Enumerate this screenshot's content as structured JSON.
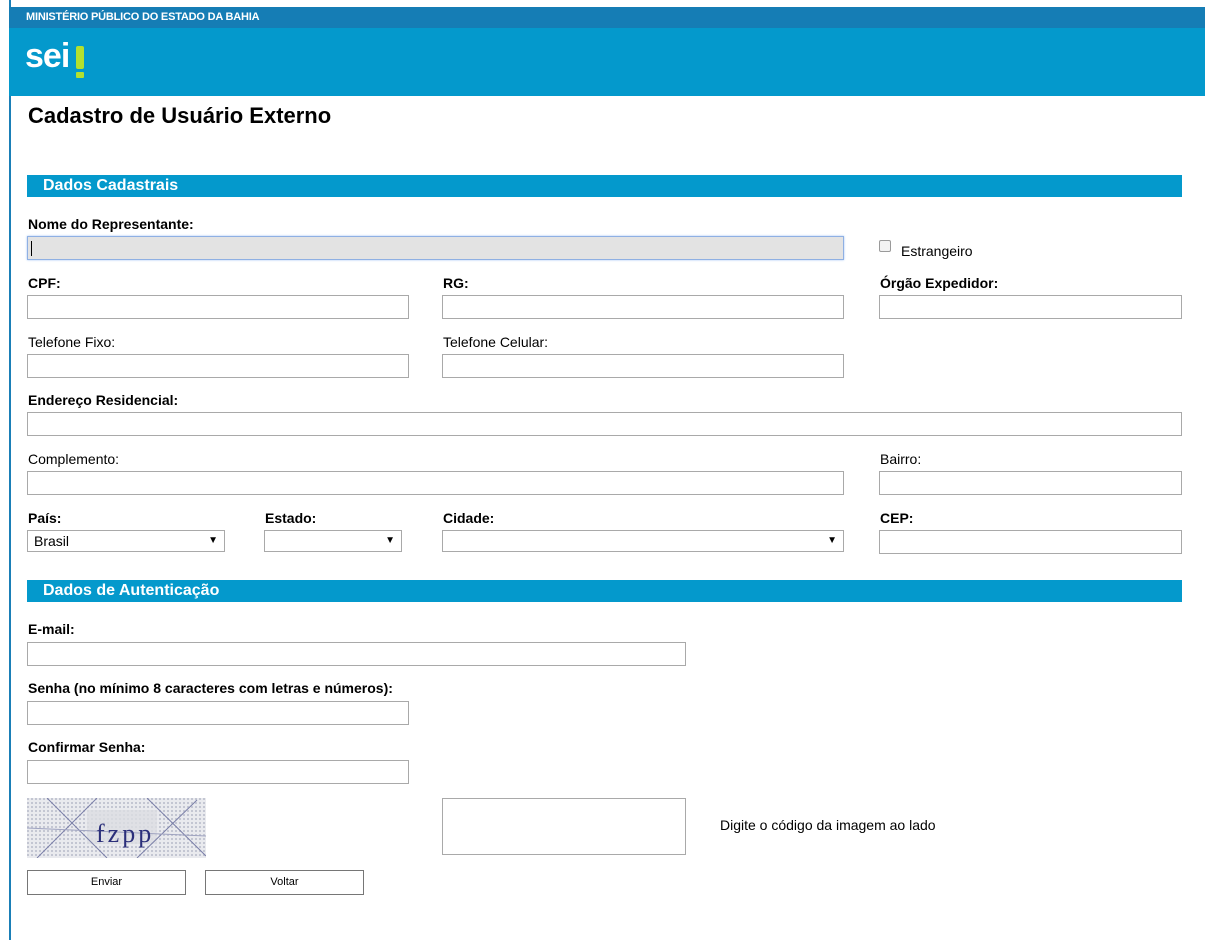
{
  "header": {
    "org_name": "MINISTÉRIO PÚBLICO DO ESTADO DA BAHIA",
    "logo_text": "sei"
  },
  "page": {
    "title": "Cadastro de Usuário Externo"
  },
  "sections": {
    "dados_cadastrais": "Dados Cadastrais",
    "dados_autenticacao": "Dados de Autenticação"
  },
  "labels": {
    "nome_representante": "Nome do Representante:",
    "estrangeiro": "Estrangeiro",
    "cpf": "CPF:",
    "rg": "RG:",
    "orgao_expedidor": "Órgão Expedidor:",
    "telefone_fixo": "Telefone Fixo:",
    "telefone_celular": "Telefone Celular:",
    "endereco_residencial": "Endereço Residencial:",
    "complemento": "Complemento:",
    "bairro": "Bairro:",
    "pais": "País:",
    "estado": "Estado:",
    "cidade": "Cidade:",
    "cep": "CEP:",
    "email": "E-mail:",
    "senha": "Senha (no mínimo 8 caracteres com letras e números):",
    "confirmar_senha": "Confirmar Senha:",
    "captcha_hint": "Digite o código da imagem ao lado"
  },
  "fields": {
    "pais_value": "Brasil",
    "estado_value": "",
    "cidade_value": ""
  },
  "captcha": {
    "code": "fzpp"
  },
  "buttons": {
    "enviar": "Enviar",
    "voltar": "Voltar"
  },
  "colors": {
    "header": "#0499cc",
    "header_strip": "#157db5",
    "logo_accent": "#b2e02f"
  }
}
